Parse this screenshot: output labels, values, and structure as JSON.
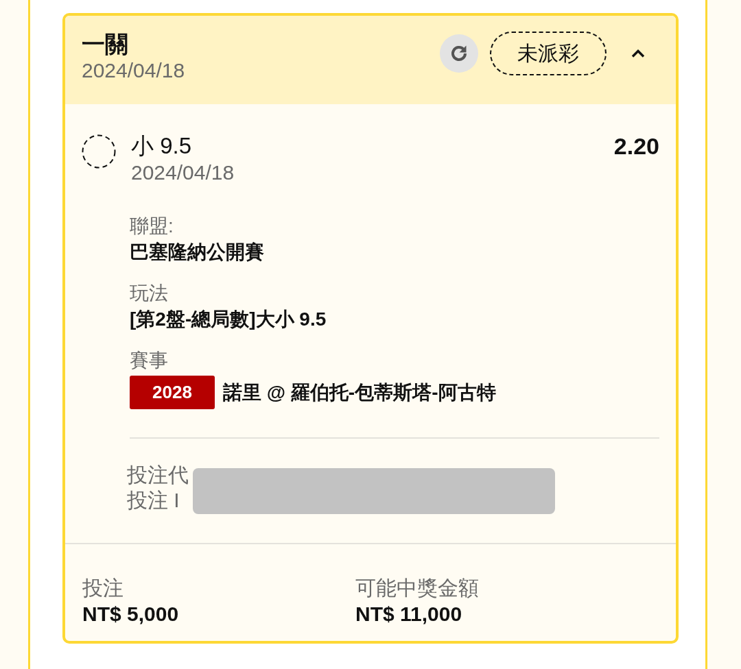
{
  "bet_card": {
    "title": "一關",
    "date": "2024/04/18",
    "status": "未派彩",
    "expanded": true
  },
  "selection": {
    "name": "小 9.5",
    "date": "2024/04/18",
    "odds": "2.20"
  },
  "details": [
    {
      "kind": "text",
      "label": "聯盟:",
      "value": "巴塞隆納公開賽"
    },
    {
      "kind": "text",
      "label": "玩法",
      "value": "[第2盤-總局數]大小 9.5"
    },
    {
      "kind": "event",
      "label": "賽事",
      "badge": "2028",
      "value": "諾里 @ 羅伯托-包蒂斯塔-阿古特"
    }
  ],
  "bet_info": {
    "lines": [
      "投注代",
      "投注 I"
    ],
    "redacted": true
  },
  "totals": [
    {
      "label": "投注",
      "value": "NT$ 5,000"
    },
    {
      "label": "可能中獎金額",
      "value": "NT$ 11,000"
    }
  ]
}
